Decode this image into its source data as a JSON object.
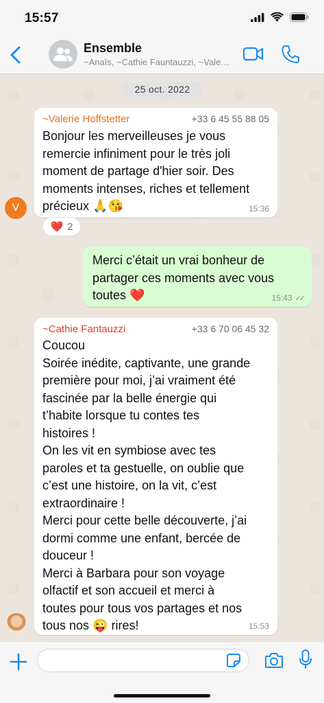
{
  "status_bar": {
    "time": "15:57"
  },
  "header": {
    "title": "Ensemble",
    "subtitle": "~Anaïs, ~Cathie Fauntauzzi, ~Vale…"
  },
  "date_separator": "25 oct. 2022",
  "messages": [
    {
      "sender": "~Valerie Hoffstetter",
      "sender_color": "#e8711c",
      "phone": "+33 6 45 55 88 05",
      "text": "Bonjour les merveilleuses je vous\nremercie infiniment pour le très joli\nmoment de partage d'hier soir. Des\nmoments intenses, riches et tellement\nprécieux 🙏😘",
      "time": "15:36",
      "avatar_letter": "V",
      "reaction": {
        "emoji": "❤️",
        "count": "2"
      }
    },
    {
      "text": "Merci c’était un vrai bonheur de\npartager ces moments avec vous\ntoutes ❤️",
      "time": "15:43",
      "ticks": "✓✓"
    },
    {
      "sender": "~Cathie Fantauzzi",
      "sender_color": "#d6452f",
      "phone": "+33 6 70 06 45 32",
      "text": "Coucou\nSoirée inédite, captivante, une grande\npremière pour moi, j’ai vraiment été\nfascinée par la belle énergie qui\nt’habite lorsque tu contes tes\nhistoires !\nOn les vit en symbiose avec tes\nparoles et ta gestuelle, on oublie que\nc’est une histoire, on la vit, c’est\nextraordinaire !\nMerci pour cette belle découverte, j’ai\ndormi comme une enfant, bercée de\ndouceur !\nMerci à Barbara pour son voyage\nolfactif et son accueil et merci à\ntoutes pour tous  vos partages et nos\ntous nos 😜 rires!",
      "time": "15:53"
    }
  ],
  "input": {
    "placeholder": ""
  },
  "icons": {
    "back": "chevron-left-icon",
    "video": "video-camera-icon",
    "call": "phone-icon",
    "plus": "plus-icon",
    "sticker": "sticker-icon",
    "camera": "camera-icon",
    "mic": "microphone-icon"
  },
  "colors": {
    "accent": "#1a8cf2",
    "outgoing_bubble": "#d9fdd3",
    "read_tick": "#8c8c8c"
  }
}
